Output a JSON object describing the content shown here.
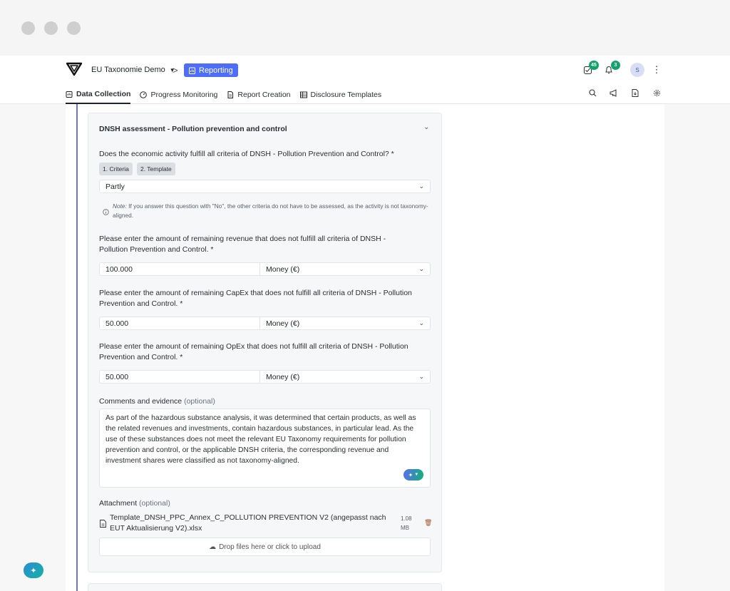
{
  "window": {
    "controls": [
      "close",
      "minimize",
      "maximize"
    ]
  },
  "header": {
    "org_name": "EU Taxonomie Demo",
    "crumb_separator": ">",
    "module_label": "Reporting",
    "tasks_badge": "45",
    "notifications_badge": "3",
    "avatar_initial": "S"
  },
  "nav": {
    "tabs": [
      {
        "label": "Data Collection",
        "icon": "clipboard-icon",
        "active": true
      },
      {
        "label": "Progress Monitoring",
        "icon": "gauge-icon",
        "active": false
      },
      {
        "label": "Report Creation",
        "icon": "document-icon",
        "active": false
      },
      {
        "label": "Disclosure Templates",
        "icon": "table-icon",
        "active": false
      }
    ],
    "right_icons": [
      "search-icon",
      "megaphone-icon",
      "file-download-icon",
      "gear-icon"
    ]
  },
  "section": {
    "title": "DNSH assessment - Pollution prevention and control",
    "question1": "Does the economic activity fulfill all criteria of DNSH - Pollution Prevention and Control? *",
    "chip1": "1. Criteria",
    "chip2": "2. Template",
    "answer1": "Partly",
    "note_label": "Note:",
    "note_text": " If you answer this question with \"No\", the other criteria do not have to be assessed, as the activity is not taxonomy-aligned.",
    "question2": "Please enter the amount of remaining revenue that does not fulfill all criteria of DNSH - Pollution Prevention and Control. *",
    "revenue_value": "100.000",
    "revenue_unit": "Money (€)",
    "question3": "Please enter the amount of remaining CapEx that does not fulfill all criteria of DNSH - Pollution Prevention and Control. *",
    "capex_value": "50.000",
    "capex_unit": "Money (€)",
    "question4": "Please enter the amount of remaining OpEx that does not fulfill all criteria of DNSH - Pollution Prevention and Control. *",
    "opex_value": "50.000",
    "opex_unit": "Money (€)",
    "comments_label": "Comments and evidence",
    "optional": "(optional)",
    "comments_text": "As part of the hazardous substance analysis, it was determined that certain products, as well as the related revenues and investments, contain hazardous substances, in particular lead. As the use of these substances does not meet the relevant EU Taxonomy requirements for pollution prevention and control, or the applicable DNSH criteria, the corresponding revenue and investment shares were classified as not taxonomy-aligned.",
    "attachment_label": "Attachment",
    "file_name": "Template_DNSH_PPC_Annex_C_POLLUTION PREVENTION V2 (angepasst nach EUT Aktualisierung V2).xlsx",
    "file_size": "1.08 MB",
    "upload_text": "Drop files here or click to upload"
  }
}
